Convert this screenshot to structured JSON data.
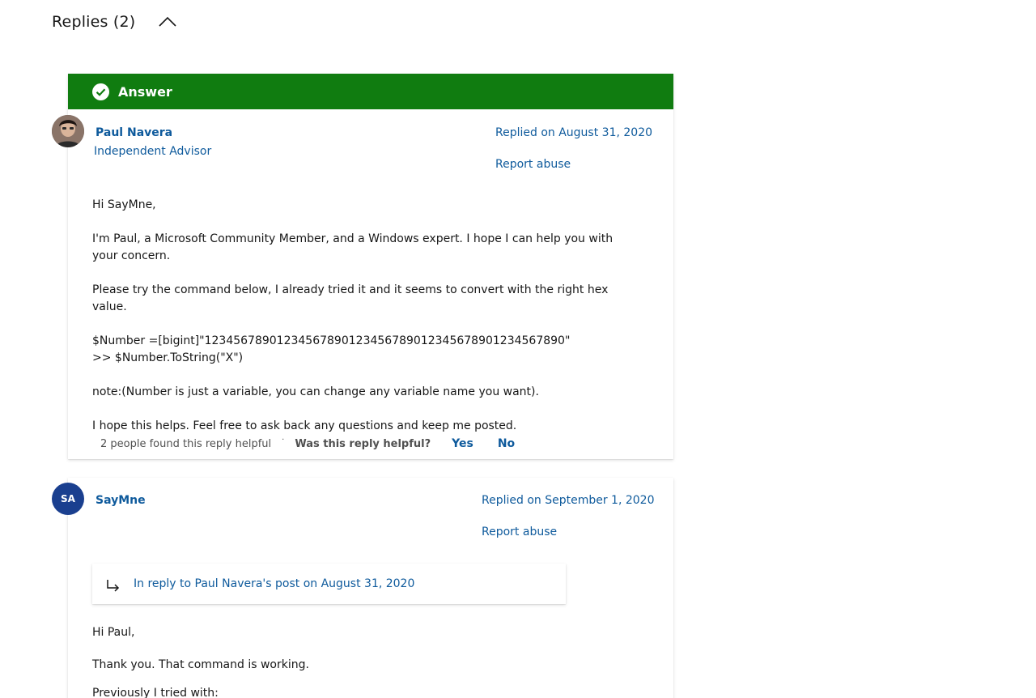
{
  "header": {
    "title": "Replies (2)"
  },
  "colors": {
    "answer_green": "#107c10",
    "link_blue": "#0e5a9c",
    "avatar_blue": "#1a3f8f"
  },
  "reply1": {
    "banner_label": "Answer",
    "author": "Paul Navera",
    "role": "Independent Advisor",
    "replied_on": "Replied on August 31, 2020",
    "report": "Report abuse",
    "paragraphs": [
      "Hi SayMne,",
      "I'm Paul, a Microsoft Community Member, and a Windows expert. I hope I can help you with your concern.",
      "Please try the command below, I already tried it and it seems to convert with the right hex value.",
      "code",
      "note:(Number is just a variable, you can change any variable name you want).",
      "I hope this helps. Feel free to ask back any questions and keep me posted."
    ],
    "code_line1": "$Number =[bigint]\"1234567890123456789012345678901234567890123456789​0\"",
    "code_line2": ">> $Number.ToString(\"X\")",
    "helpful_count": "2 people found this reply helpful",
    "helpful_question": "Was this reply helpful?",
    "yes_label": "Yes",
    "no_label": "No"
  },
  "reply2": {
    "author": "SayMne",
    "initials": "SA",
    "replied_on": "Replied on September 1, 2020",
    "report": "Report abuse",
    "in_reply_to": "In reply to Paul Navera's post on August 31, 2020",
    "line1": "Hi Paul,",
    "line2": "Thank you. That command is working.",
    "line3": "Previously I tried with:"
  },
  "icons": {
    "collapse": "chevron-up-icon",
    "answer": "check-circle-icon",
    "reply": "reply-arrow-icon"
  }
}
